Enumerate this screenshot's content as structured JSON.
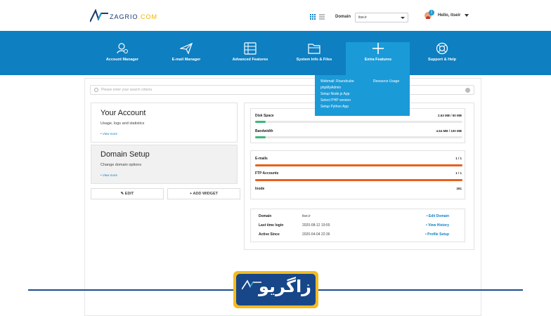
{
  "header": {
    "logo_text": "ZAGRIO",
    "logo_suffix": ".COM",
    "domain_label": "Domain",
    "domain_value": "itse.ir",
    "user_greeting": "Hello, itseir",
    "notification_count": "1"
  },
  "nav": {
    "items": [
      {
        "label": "Account Manager",
        "icon": "user-gear-icon"
      },
      {
        "label": "E-mail Manager",
        "icon": "paper-plane-icon"
      },
      {
        "label": "Advanced Features",
        "icon": "list-icon"
      },
      {
        "label": "System Info & Files",
        "icon": "folder-icon"
      },
      {
        "label": "Extra Features",
        "icon": "plus-icon"
      },
      {
        "label": "Support & Help",
        "icon": "lifebuoy-icon"
      }
    ]
  },
  "dropdown": {
    "col1": [
      "Webmail: Roundcube",
      "phpMyAdmin",
      "Setup Node.js App",
      "Select PHP version",
      "Setup Python App"
    ],
    "col2": [
      "Resource Usage"
    ]
  },
  "search": {
    "placeholder": "Please enter your search criteria"
  },
  "account": {
    "title": "Your Account",
    "subtitle": "Usage, logs and statistics",
    "link": "• View more"
  },
  "domain_setup": {
    "title": "Domain Setup",
    "subtitle": "Change domain options",
    "link": "• View more"
  },
  "buttons": {
    "edit": "EDIT",
    "add_widget": "ADD WIDGET"
  },
  "usage": {
    "disk": {
      "label": "Disk Space",
      "value": "2.63 MB / 50 MB",
      "fraction": 0.05,
      "color": "#3cb878"
    },
    "bandwidth": {
      "label": "Bandwidth",
      "value": "4.64 MB / 100 MB",
      "fraction": 0.05,
      "color": "#3cb878"
    }
  },
  "counts": {
    "emails": {
      "label": "E-mails",
      "value": "1 / 1",
      "fraction": 1.0,
      "color": "#e8601c"
    },
    "ftp": {
      "label": "FTP Accounts",
      "value": "1 / 1",
      "fraction": 1.0,
      "color": "#e8601c"
    },
    "inode": {
      "label": "Inode",
      "value": "261"
    }
  },
  "info": [
    {
      "key": "Domain",
      "value": "itse.ir",
      "action": "• Edit Domain"
    },
    {
      "key": "Last time login",
      "value": "2020-08-12 19:55",
      "action": "• View History"
    },
    {
      "key": "Active Since",
      "value": "2020-04-04 22:36",
      "action": "• Profile Setup"
    }
  ],
  "footer": {
    "brand_text": "زاگریو"
  }
}
